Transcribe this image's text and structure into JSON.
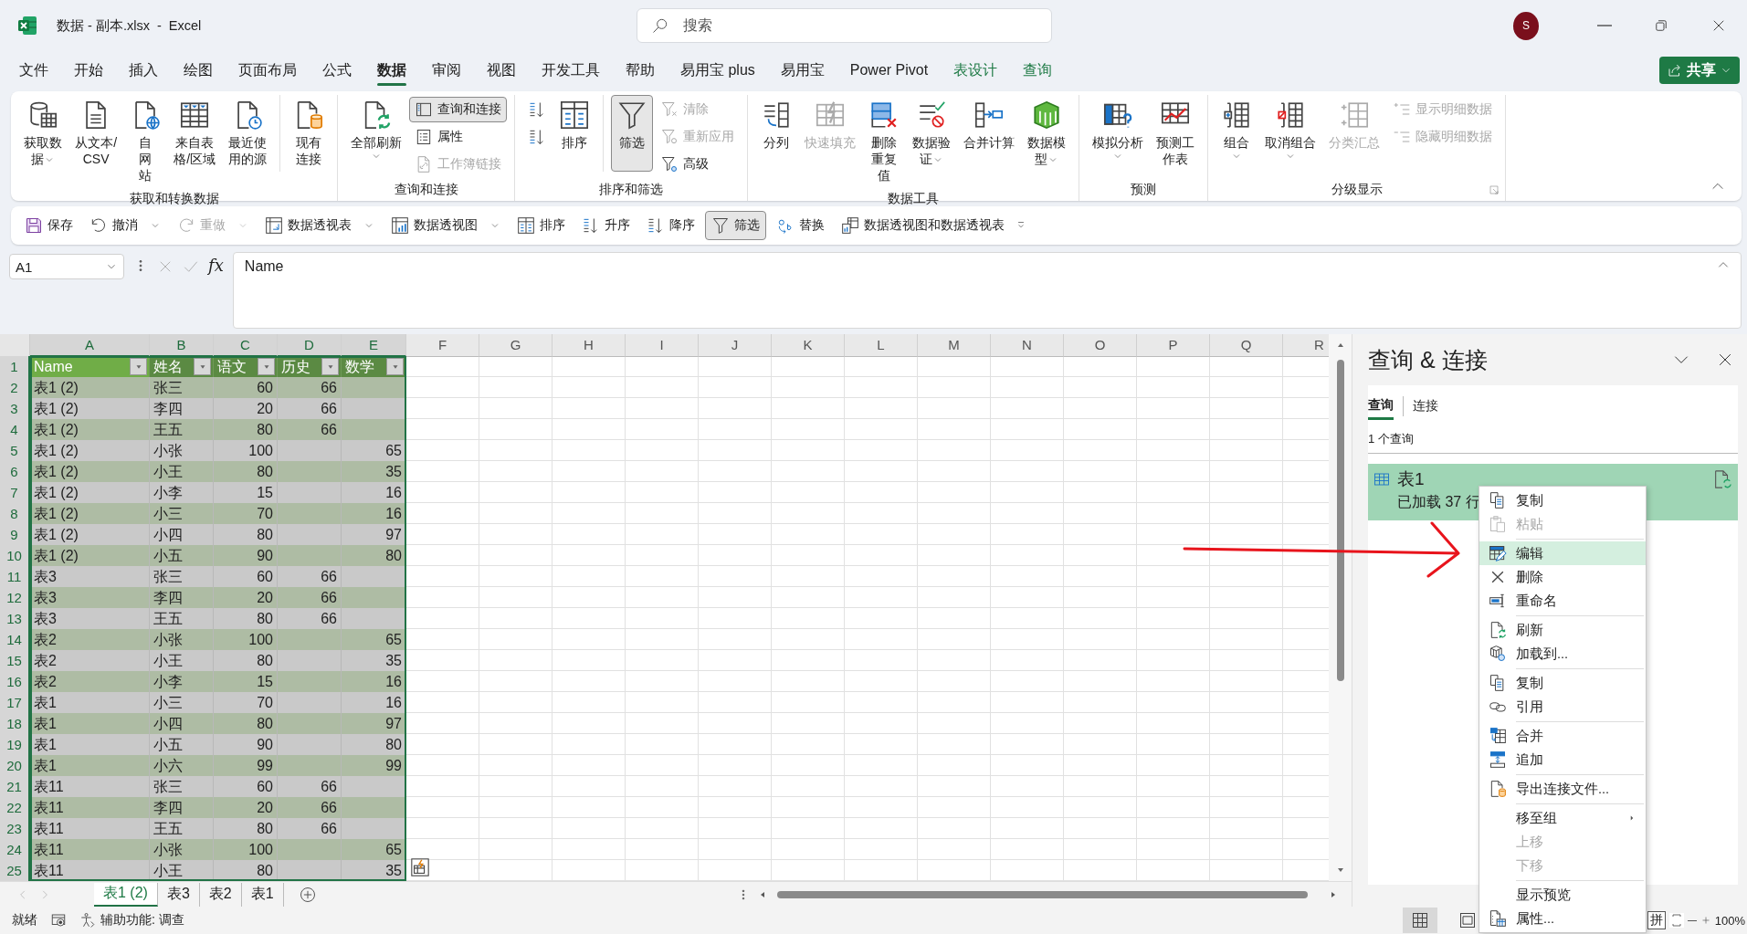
{
  "window": {
    "title": "数据 - 副本.xlsx  -  Excel",
    "search_placeholder": "搜索",
    "avatar": "S"
  },
  "ribbon_tabs": [
    {
      "label": "文件",
      "selected": false,
      "kind": "normal"
    },
    {
      "label": "开始",
      "selected": false,
      "kind": "normal"
    },
    {
      "label": "插入",
      "selected": false,
      "kind": "normal"
    },
    {
      "label": "绘图",
      "selected": false,
      "kind": "normal"
    },
    {
      "label": "页面布局",
      "selected": false,
      "kind": "normal"
    },
    {
      "label": "公式",
      "selected": false,
      "kind": "normal"
    },
    {
      "label": "数据",
      "selected": true,
      "kind": "normal"
    },
    {
      "label": "审阅",
      "selected": false,
      "kind": "normal"
    },
    {
      "label": "视图",
      "selected": false,
      "kind": "normal"
    },
    {
      "label": "开发工具",
      "selected": false,
      "kind": "normal"
    },
    {
      "label": "帮助",
      "selected": false,
      "kind": "normal"
    },
    {
      "label": "易用宝 plus",
      "selected": false,
      "kind": "normal"
    },
    {
      "label": "易用宝",
      "selected": false,
      "kind": "normal"
    },
    {
      "label": "Power Pivot",
      "selected": false,
      "kind": "normal"
    },
    {
      "label": "表设计",
      "selected": false,
      "kind": "contextual"
    },
    {
      "label": "查询",
      "selected": false,
      "kind": "contextual"
    }
  ],
  "share_button": "共享",
  "ribbon_groups": [
    {
      "label": "获取和转换数据",
      "columns": [
        {
          "kind": "large",
          "label": "获取数据",
          "dropdown": true,
          "disabled": false,
          "pressed": false
        },
        {
          "kind": "large",
          "label": "从文本/CSV",
          "dropdown": false,
          "disabled": false,
          "pressed": false
        },
        {
          "kind": "large",
          "label": "自网站",
          "dropdown": false,
          "disabled": false,
          "pressed": false
        },
        {
          "kind": "large",
          "label": "来自表格/区域",
          "dropdown": false,
          "disabled": false,
          "pressed": false
        },
        {
          "kind": "large",
          "label": "最近使用的源",
          "dropdown": false,
          "disabled": false,
          "pressed": false
        },
        {
          "kind": "separator"
        },
        {
          "kind": "large",
          "label": "现有连接",
          "dropdown": false,
          "disabled": false,
          "pressed": false
        }
      ]
    },
    {
      "label": "查询和连接",
      "columns": [
        {
          "kind": "large",
          "label": "全部刷新",
          "dropdown": true,
          "disabled": false,
          "pressed": false
        },
        {
          "kind": "stack",
          "items": [
            {
              "label": "查询和连接",
              "disabled": false,
              "pressed": true
            },
            {
              "label": "属性",
              "disabled": false,
              "pressed": false
            },
            {
              "label": "工作簿链接",
              "disabled": true,
              "pressed": false
            }
          ]
        }
      ]
    },
    {
      "label": "排序和筛选",
      "columns": [
        {
          "kind": "stack",
          "items": [
            {
              "disabled": false,
              "pressed": false
            },
            {
              "disabled": false,
              "pressed": false
            }
          ]
        },
        {
          "kind": "large",
          "label": "排序",
          "dropdown": false,
          "disabled": false,
          "pressed": false
        },
        {
          "kind": "separator"
        },
        {
          "kind": "large",
          "label": "筛选",
          "dropdown": false,
          "disabled": false,
          "pressed": true
        },
        {
          "kind": "stack",
          "items": [
            {
              "label": "清除",
              "disabled": true,
              "pressed": false
            },
            {
              "label": "重新应用",
              "disabled": true,
              "pressed": false
            },
            {
              "label": "高级",
              "disabled": false,
              "pressed": false
            }
          ]
        }
      ]
    },
    {
      "label": "数据工具",
      "columns": [
        {
          "kind": "large",
          "label": "分列",
          "dropdown": false,
          "disabled": false,
          "pressed": false
        },
        {
          "kind": "large",
          "label": "快速填充",
          "dropdown": false,
          "disabled": true,
          "pressed": false
        },
        {
          "kind": "large",
          "label": "删除重复值",
          "dropdown": false,
          "disabled": false,
          "pressed": false
        },
        {
          "kind": "large",
          "label": "数据验证",
          "dropdown": true,
          "disabled": false,
          "pressed": false
        },
        {
          "kind": "large",
          "label": "合并计算",
          "dropdown": false,
          "disabled": false,
          "pressed": false
        },
        {
          "kind": "large",
          "label": "数据模型",
          "dropdown": true,
          "disabled": false,
          "pressed": false
        }
      ]
    },
    {
      "label": "预测",
      "columns": [
        {
          "kind": "large",
          "label": "模拟分析",
          "dropdown": true,
          "disabled": false,
          "pressed": false
        },
        {
          "kind": "large",
          "label": "预测工作表",
          "dropdown": false,
          "disabled": false,
          "pressed": false
        }
      ]
    },
    {
      "label": "分级显示",
      "columns": [
        {
          "kind": "large",
          "label": "组合",
          "dropdown": true,
          "disabled": false,
          "pressed": false
        },
        {
          "kind": "large",
          "label": "取消组合",
          "dropdown": true,
          "disabled": false,
          "pressed": false
        },
        {
          "kind": "large",
          "label": "分类汇总",
          "dropdown": false,
          "disabled": true,
          "pressed": false
        },
        {
          "kind": "stack",
          "items": [
            {
              "label": "显示明细数据",
              "disabled": true,
              "pressed": false
            },
            {
              "label": "隐藏明细数据",
              "disabled": true,
              "pressed": false
            }
          ]
        }
      ]
    }
  ],
  "quick_access": [
    {
      "label": "保存",
      "dropdown": false,
      "disabled": false,
      "pressed": false
    },
    {
      "label": "撤消",
      "dropdown": true,
      "disabled": false,
      "pressed": false
    },
    {
      "label": "重做",
      "dropdown": true,
      "disabled": true,
      "pressed": false
    },
    {
      "label": "数据透视表",
      "dropdown": true,
      "disabled": false,
      "pressed": false
    },
    {
      "label": "数据透视图",
      "dropdown": true,
      "disabled": false,
      "pressed": false
    },
    {
      "label": "排序",
      "dropdown": false,
      "disabled": false,
      "pressed": false
    },
    {
      "label": "升序",
      "dropdown": false,
      "disabled": false,
      "pressed": false
    },
    {
      "label": "降序",
      "dropdown": false,
      "disabled": false,
      "pressed": false
    },
    {
      "label": "筛选",
      "dropdown": false,
      "disabled": false,
      "pressed": true
    },
    {
      "label": "替换",
      "dropdown": false,
      "disabled": false,
      "pressed": false
    },
    {
      "label": "数据透视图和数据透视表",
      "dropdown": false,
      "disabled": false,
      "pressed": false
    }
  ],
  "formula_bar": {
    "name_box": "A1",
    "fx": "fx",
    "value": "Name"
  },
  "sheet": {
    "columns": [
      {
        "label": "A",
        "selected": true
      },
      {
        "label": "B",
        "selected": true
      },
      {
        "label": "C",
        "selected": true
      },
      {
        "label": "D",
        "selected": true
      },
      {
        "label": "E",
        "selected": true
      },
      {
        "label": "F",
        "selected": false
      },
      {
        "label": "G",
        "selected": false
      },
      {
        "label": "H",
        "selected": false
      },
      {
        "label": "I",
        "selected": false
      },
      {
        "label": "J",
        "selected": false
      },
      {
        "label": "K",
        "selected": false
      },
      {
        "label": "L",
        "selected": false
      },
      {
        "label": "M",
        "selected": false
      },
      {
        "label": "N",
        "selected": false
      },
      {
        "label": "O",
        "selected": false
      },
      {
        "label": "P",
        "selected": false
      },
      {
        "label": "Q",
        "selected": false
      },
      {
        "label": "R",
        "selected": false
      }
    ],
    "header_row": {
      "number": "1",
      "cells": [
        "Name",
        "姓名",
        "语文",
        "历史",
        "数学"
      ]
    },
    "rows": [
      {
        "number": "2",
        "cells": [
          "表1 (2)",
          "张三",
          "60",
          "66",
          ""
        ]
      },
      {
        "number": "3",
        "cells": [
          "表1 (2)",
          "李四",
          "20",
          "66",
          ""
        ]
      },
      {
        "number": "4",
        "cells": [
          "表1 (2)",
          "王五",
          "80",
          "66",
          ""
        ]
      },
      {
        "number": "5",
        "cells": [
          "表1 (2)",
          "小张",
          "100",
          "",
          "65"
        ]
      },
      {
        "number": "6",
        "cells": [
          "表1 (2)",
          "小王",
          "80",
          "",
          "35"
        ]
      },
      {
        "number": "7",
        "cells": [
          "表1 (2)",
          "小李",
          "15",
          "",
          "16"
        ]
      },
      {
        "number": "8",
        "cells": [
          "表1 (2)",
          "小三",
          "70",
          "",
          "16"
        ]
      },
      {
        "number": "9",
        "cells": [
          "表1 (2)",
          "小四",
          "80",
          "",
          "97"
        ]
      },
      {
        "number": "10",
        "cells": [
          "表1 (2)",
          "小五",
          "90",
          "",
          "80"
        ]
      },
      {
        "number": "11",
        "cells": [
          "表3",
          "张三",
          "60",
          "66",
          ""
        ]
      },
      {
        "number": "12",
        "cells": [
          "表3",
          "李四",
          "20",
          "66",
          ""
        ]
      },
      {
        "number": "13",
        "cells": [
          "表3",
          "王五",
          "80",
          "66",
          ""
        ]
      },
      {
        "number": "14",
        "cells": [
          "表2",
          "小张",
          "100",
          "",
          "65"
        ]
      },
      {
        "number": "15",
        "cells": [
          "表2",
          "小王",
          "80",
          "",
          "35"
        ]
      },
      {
        "number": "16",
        "cells": [
          "表2",
          "小李",
          "15",
          "",
          "16"
        ]
      },
      {
        "number": "17",
        "cells": [
          "表1",
          "小三",
          "70",
          "",
          "16"
        ]
      },
      {
        "number": "18",
        "cells": [
          "表1",
          "小四",
          "80",
          "",
          "97"
        ]
      },
      {
        "number": "19",
        "cells": [
          "表1",
          "小五",
          "90",
          "",
          "80"
        ]
      },
      {
        "number": "20",
        "cells": [
          "表1",
          "小六",
          "99",
          "",
          "99"
        ]
      },
      {
        "number": "21",
        "cells": [
          "表11",
          "张三",
          "60",
          "66",
          ""
        ]
      },
      {
        "number": "22",
        "cells": [
          "表11",
          "李四",
          "20",
          "66",
          ""
        ]
      },
      {
        "number": "23",
        "cells": [
          "表11",
          "王五",
          "80",
          "66",
          ""
        ]
      },
      {
        "number": "24",
        "cells": [
          "表11",
          "小张",
          "100",
          "",
          "65"
        ]
      },
      {
        "number": "25",
        "cells": [
          "表11",
          "小王",
          "80",
          "",
          "35"
        ]
      }
    ]
  },
  "sheet_tabs": [
    {
      "label": "表1 (2)",
      "selected": true
    },
    {
      "label": "表3",
      "selected": false
    },
    {
      "label": "表2",
      "selected": false
    },
    {
      "label": "表1",
      "selected": false
    }
  ],
  "status_bar": {
    "ready": "就绪",
    "accessibility": "辅助功能: 调查",
    "ime": "拼",
    "zoom": "100%"
  },
  "query_pane": {
    "title": "查询 & 连接",
    "tabs": [
      {
        "label": "查询",
        "selected": true
      },
      {
        "label": "连接",
        "selected": false
      }
    ],
    "count": "1 个查询",
    "queries": [
      {
        "name": "表1",
        "status": "已加载 37 行"
      }
    ]
  },
  "context_menu": [
    {
      "kind": "item",
      "label": "复制",
      "disabled": false,
      "selected": false,
      "submenu": false
    },
    {
      "kind": "item",
      "label": "粘贴",
      "disabled": true,
      "selected": false,
      "submenu": false
    },
    {
      "kind": "separator"
    },
    {
      "kind": "item",
      "label": "编辑",
      "disabled": false,
      "selected": true,
      "submenu": false
    },
    {
      "kind": "item",
      "label": "删除",
      "disabled": false,
      "selected": false,
      "submenu": false
    },
    {
      "kind": "item",
      "label": "重命名",
      "disabled": false,
      "selected": false,
      "submenu": false
    },
    {
      "kind": "separator"
    },
    {
      "kind": "item",
      "label": "刷新",
      "disabled": false,
      "selected": false,
      "submenu": false
    },
    {
      "kind": "item",
      "label": "加载到...",
      "disabled": false,
      "selected": false,
      "submenu": false
    },
    {
      "kind": "separator"
    },
    {
      "kind": "item",
      "label": "复制",
      "disabled": false,
      "selected": false,
      "submenu": false
    },
    {
      "kind": "item",
      "label": "引用",
      "disabled": false,
      "selected": false,
      "submenu": false
    },
    {
      "kind": "separator"
    },
    {
      "kind": "item",
      "label": "合并",
      "disabled": false,
      "selected": false,
      "submenu": false
    },
    {
      "kind": "item",
      "label": "追加",
      "disabled": false,
      "selected": false,
      "submenu": false
    },
    {
      "kind": "separator"
    },
    {
      "kind": "item",
      "label": "导出连接文件...",
      "disabled": false,
      "selected": false,
      "submenu": false
    },
    {
      "kind": "separator"
    },
    {
      "kind": "item",
      "label": "移至组",
      "disabled": false,
      "selected": false,
      "submenu": true
    },
    {
      "kind": "item",
      "label": "上移",
      "disabled": true,
      "selected": false,
      "submenu": false
    },
    {
      "kind": "item",
      "label": "下移",
      "disabled": true,
      "selected": false,
      "submenu": false
    },
    {
      "kind": "separator"
    },
    {
      "kind": "item",
      "label": "显示预览",
      "disabled": false,
      "selected": false,
      "submenu": false
    },
    {
      "kind": "item",
      "label": "属性...",
      "disabled": false,
      "selected": false,
      "submenu": false
    }
  ]
}
